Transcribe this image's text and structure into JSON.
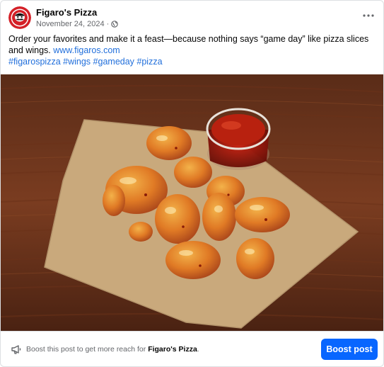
{
  "post": {
    "page_name": "Figaro's Pizza",
    "date": "November 24, 2024",
    "separator": "·",
    "privacy_icon": "globe-icon",
    "more_icon": "more-dots-icon",
    "caption": {
      "text": "Order your favorites and make it a feast—because nothing says “game day” like pizza slices and wings.",
      "link": "www.figaros.com",
      "hashtags": [
        "#figarospizza",
        "#wings",
        "#gameday",
        "#pizza"
      ]
    },
    "photo_icon": "food-photo-chicken-wings"
  },
  "boost": {
    "icon": "megaphone-icon",
    "text_prefix": "Boost this post to get more reach for",
    "page_name": "Figaro's Pizza",
    "text_suffix": ".",
    "button_label": "Boost post"
  },
  "colors": {
    "link": "#216fdb",
    "button": "#0866ff",
    "secondary_text": "#65676b",
    "brand_red": "#d42027"
  }
}
